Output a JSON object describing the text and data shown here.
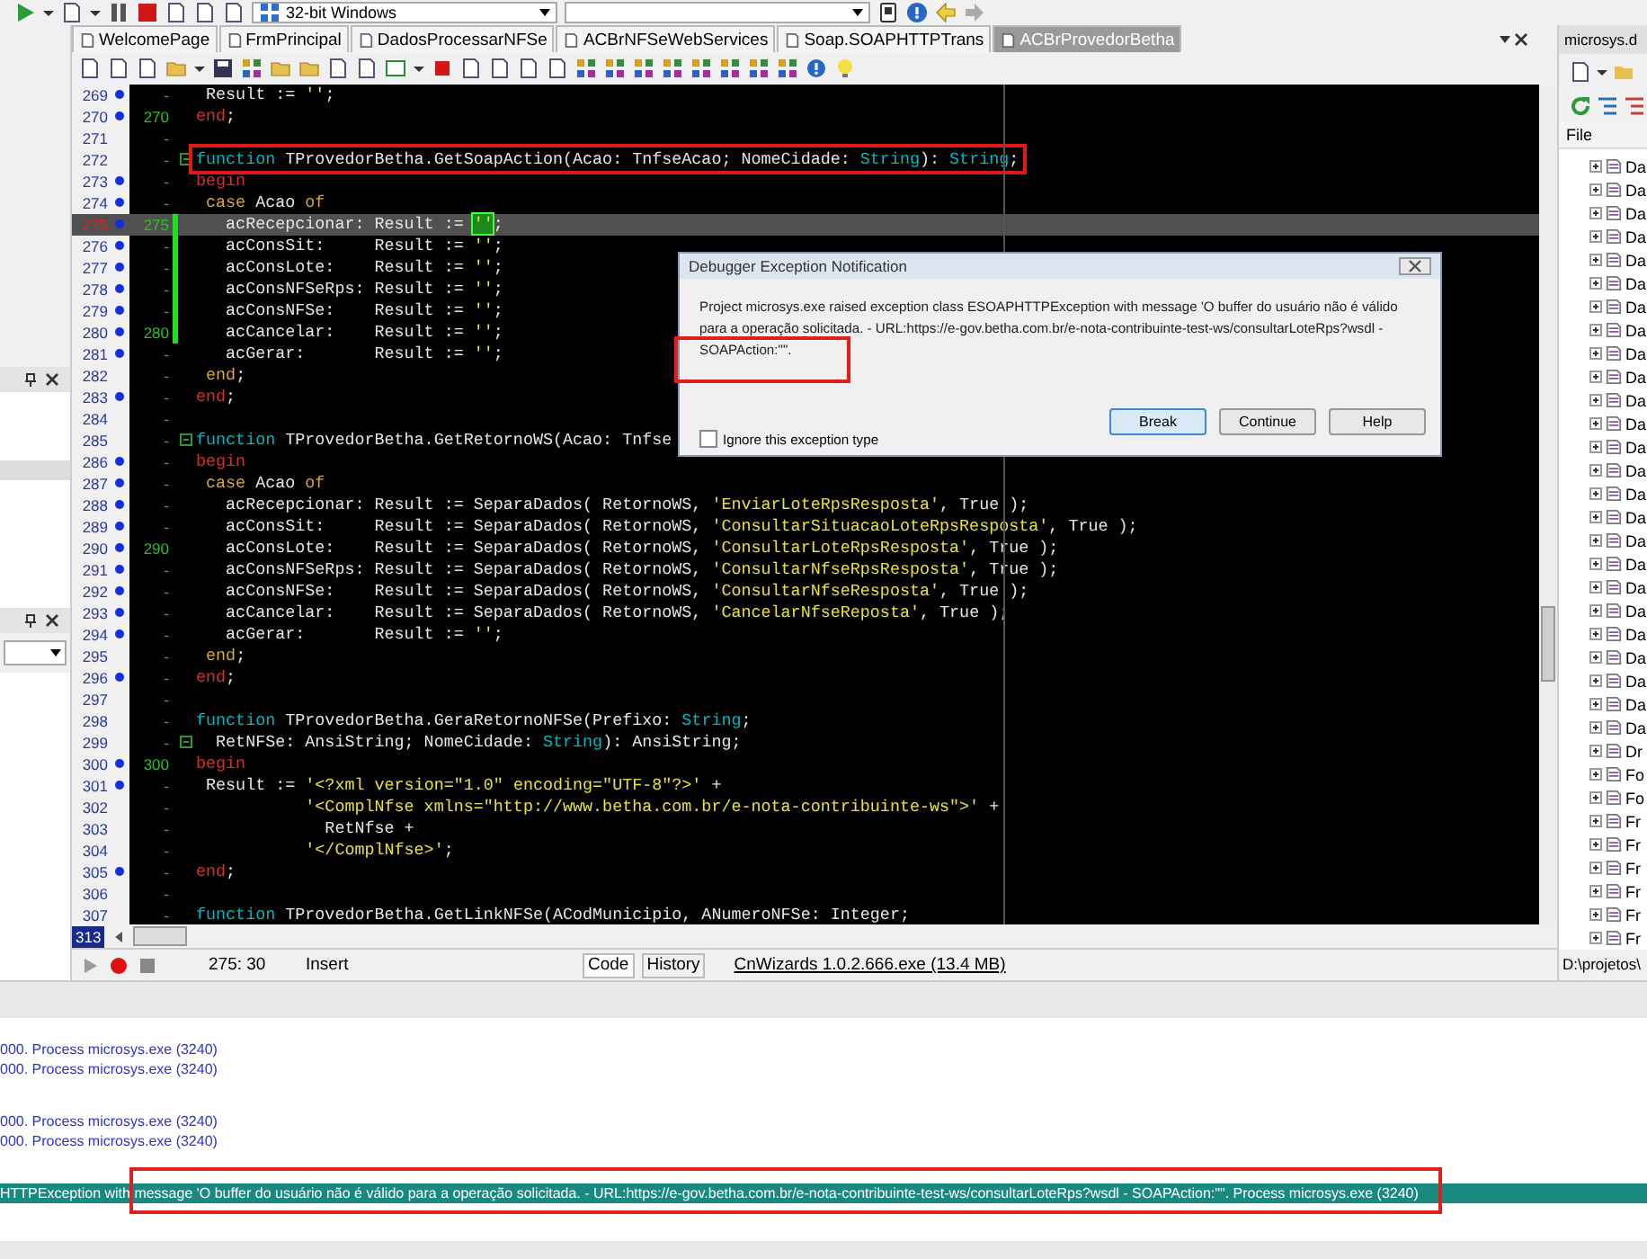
{
  "toolbar": {
    "platform": "32-bit Windows"
  },
  "editor_tabs": [
    {
      "label": "WelcomePage",
      "selected": false
    },
    {
      "label": "FrmPrincipal",
      "selected": false
    },
    {
      "label": "DadosProcessarNFSe",
      "selected": false
    },
    {
      "label": "ACBrNFSeWebServices",
      "selected": false
    },
    {
      "label": "Soap.SOAPHTTPTrans",
      "selected": false
    },
    {
      "label": "ACBrProvedorBetha",
      "selected": true
    }
  ],
  "code": {
    "lines": [
      {
        "n": "269",
        "dot": true,
        "mark": "-",
        "fold": false,
        "changed": false,
        "current": false,
        "boxed": false,
        "tokens": [
          {
            "text": " Result := ",
            "kind": "plain"
          },
          {
            "text": "''",
            "kind": "string"
          },
          {
            "text": ";",
            "kind": "plain"
          }
        ]
      },
      {
        "n": "270",
        "dot": true,
        "mark": "270",
        "fold": false,
        "changed": false,
        "current": false,
        "boxed": false,
        "tokens": [
          {
            "text": "end",
            "kind": "block"
          },
          {
            "text": ";",
            "kind": "plain"
          }
        ]
      },
      {
        "n": "271",
        "dot": false,
        "mark": "-",
        "fold": false,
        "changed": false,
        "current": false
      },
      {
        "n": "272",
        "dot": false,
        "mark": "-",
        "fold": true,
        "changed": false,
        "current": false,
        "boxed": true,
        "tokens": [
          {
            "text": "function",
            "kind": "keyword"
          },
          {
            "text": " TProvedorBetha.GetSoapAction(Acao: TnfseAcao; NomeCidade: ",
            "kind": "plain"
          },
          {
            "text": "String",
            "kind": "keyword"
          },
          {
            "text": "): ",
            "kind": "plain"
          },
          {
            "text": "String",
            "kind": "keyword"
          },
          {
            "text": ";",
            "kind": "plain"
          }
        ]
      },
      {
        "n": "273",
        "dot": true,
        "mark": "-",
        "fold": false,
        "changed": false,
        "current": false,
        "boxed": false,
        "tokens": [
          {
            "text": "begin",
            "kind": "block"
          }
        ]
      },
      {
        "n": "274",
        "dot": true,
        "mark": "-",
        "fold": false,
        "changed": false,
        "current": false,
        "boxed": false,
        "tokens": [
          {
            "text": " case",
            "kind": "control"
          },
          {
            "text": " Acao ",
            "kind": "plain"
          },
          {
            "text": "of",
            "kind": "control"
          }
        ]
      },
      {
        "n": "275",
        "dot": true,
        "mark": "275",
        "fold": false,
        "changed": true,
        "current": true,
        "boxed": false,
        "tokens": [
          {
            "text": "   acRecepcionar: Result := ",
            "kind": "plain"
          },
          {
            "text": "''",
            "kind": "cursor"
          },
          {
            "text": ";",
            "kind": "plain"
          }
        ]
      },
      {
        "n": "276",
        "dot": true,
        "mark": "-",
        "fold": false,
        "changed": true,
        "current": false,
        "boxed": false,
        "tokens": [
          {
            "text": "   acConsSit:     Result := ",
            "kind": "plain"
          },
          {
            "text": "''",
            "kind": "string"
          },
          {
            "text": ";",
            "kind": "plain"
          }
        ]
      },
      {
        "n": "277",
        "dot": true,
        "mark": "-",
        "fold": false,
        "changed": true,
        "current": false,
        "boxed": false,
        "tokens": [
          {
            "text": "   acConsLote:    Result := ",
            "kind": "plain"
          },
          {
            "text": "''",
            "kind": "string"
          },
          {
            "text": ";",
            "kind": "plain"
          }
        ]
      },
      {
        "n": "278",
        "dot": true,
        "mark": "-",
        "fold": false,
        "changed": true,
        "current": false,
        "boxed": false,
        "tokens": [
          {
            "text": "   acConsNFSeRps: Result := ",
            "kind": "plain"
          },
          {
            "text": "''",
            "kind": "string"
          },
          {
            "text": ";",
            "kind": "plain"
          }
        ]
      },
      {
        "n": "279",
        "dot": true,
        "mark": "-",
        "fold": false,
        "changed": true,
        "current": false,
        "boxed": false,
        "tokens": [
          {
            "text": "   acConsNFSe:    Result := ",
            "kind": "plain"
          },
          {
            "text": "''",
            "kind": "string"
          },
          {
            "text": ";",
            "kind": "plain"
          }
        ]
      },
      {
        "n": "280",
        "dot": true,
        "mark": "280",
        "fold": false,
        "changed": true,
        "current": false,
        "boxed": false,
        "tokens": [
          {
            "text": "   acCancelar:    Result := ",
            "kind": "plain"
          },
          {
            "text": "''",
            "kind": "string"
          },
          {
            "text": ";",
            "kind": "plain"
          }
        ]
      },
      {
        "n": "281",
        "dot": true,
        "mark": "-",
        "fold": false,
        "changed": false,
        "current": false,
        "boxed": false,
        "tokens": [
          {
            "text": "   acGerar:       Result := ",
            "kind": "plain"
          },
          {
            "text": "''",
            "kind": "string"
          },
          {
            "text": ";",
            "kind": "plain"
          }
        ]
      },
      {
        "n": "282",
        "dot": false,
        "mark": "-",
        "fold": false,
        "changed": false,
        "current": false,
        "boxed": false,
        "tokens": [
          {
            "text": " end",
            "kind": "control"
          },
          {
            "text": ";",
            "kind": "plain"
          }
        ]
      },
      {
        "n": "283",
        "dot": true,
        "mark": "-",
        "fold": false,
        "changed": false,
        "current": false,
        "boxed": false,
        "tokens": [
          {
            "text": "end",
            "kind": "block"
          },
          {
            "text": ";",
            "kind": "plain"
          }
        ]
      },
      {
        "n": "284",
        "dot": false,
        "mark": "-",
        "fold": false,
        "changed": false,
        "current": false
      },
      {
        "n": "285",
        "dot": false,
        "mark": "-",
        "fold": true,
        "changed": false,
        "current": false,
        "boxed": false,
        "tokens": [
          {
            "text": "function",
            "kind": "keyword"
          },
          {
            "text": " TProvedorBetha.GetRetornoWS(Acao: Tnfse",
            "kind": "plain"
          }
        ]
      },
      {
        "n": "286",
        "dot": true,
        "mark": "-",
        "fold": false,
        "changed": false,
        "current": false,
        "boxed": false,
        "tokens": [
          {
            "text": "begin",
            "kind": "block"
          }
        ]
      },
      {
        "n": "287",
        "dot": true,
        "mark": "-",
        "fold": false,
        "changed": false,
        "current": false,
        "boxed": false,
        "tokens": [
          {
            "text": " case",
            "kind": "control"
          },
          {
            "text": " Acao ",
            "kind": "plain"
          },
          {
            "text": "of",
            "kind": "control"
          }
        ]
      },
      {
        "n": "288",
        "dot": true,
        "mark": "-",
        "fold": false,
        "changed": false,
        "current": false,
        "boxed": false,
        "tokens": [
          {
            "text": "   acRecepcionar: Result := SeparaDados( RetornoWS, ",
            "kind": "plain"
          },
          {
            "text": "'EnviarLoteRpsResposta'",
            "kind": "string"
          },
          {
            "text": ", True );",
            "kind": "plain"
          }
        ]
      },
      {
        "n": "289",
        "dot": true,
        "mark": "-",
        "fold": false,
        "changed": false,
        "current": false,
        "boxed": false,
        "tokens": [
          {
            "text": "   acConsSit:     Result := SeparaDados( RetornoWS, ",
            "kind": "plain"
          },
          {
            "text": "'ConsultarSituacaoLoteRpsResposta'",
            "kind": "string"
          },
          {
            "text": ", True );",
            "kind": "plain"
          }
        ]
      },
      {
        "n": "290",
        "dot": true,
        "mark": "290",
        "fold": false,
        "changed": false,
        "current": false,
        "boxed": false,
        "tokens": [
          {
            "text": "   acConsLote:    Result := SeparaDados( RetornoWS, ",
            "kind": "plain"
          },
          {
            "text": "'ConsultarLoteRpsResposta'",
            "kind": "string"
          },
          {
            "text": ", True );",
            "kind": "plain"
          }
        ]
      },
      {
        "n": "291",
        "dot": true,
        "mark": "-",
        "fold": false,
        "changed": false,
        "current": false,
        "boxed": false,
        "tokens": [
          {
            "text": "   acConsNFSeRps: Result := SeparaDados( RetornoWS, ",
            "kind": "plain"
          },
          {
            "text": "'ConsultarNfseRpsResposta'",
            "kind": "string"
          },
          {
            "text": ", True );",
            "kind": "plain"
          }
        ]
      },
      {
        "n": "292",
        "dot": true,
        "mark": "-",
        "fold": false,
        "changed": false,
        "current": false,
        "boxed": false,
        "tokens": [
          {
            "text": "   acConsNFSe:    Result := SeparaDados( RetornoWS, ",
            "kind": "plain"
          },
          {
            "text": "'ConsultarNfseResposta'",
            "kind": "string"
          },
          {
            "text": ", True );",
            "kind": "plain"
          }
        ]
      },
      {
        "n": "293",
        "dot": true,
        "mark": "-",
        "fold": false,
        "changed": false,
        "current": false,
        "boxed": false,
        "tokens": [
          {
            "text": "   acCancelar:    Result := SeparaDados( RetornoWS, ",
            "kind": "plain"
          },
          {
            "text": "'CancelarNfseReposta'",
            "kind": "string"
          },
          {
            "text": ", True );",
            "kind": "plain"
          }
        ]
      },
      {
        "n": "294",
        "dot": true,
        "mark": "-",
        "fold": false,
        "changed": false,
        "current": false,
        "boxed": false,
        "tokens": [
          {
            "text": "   acGerar:       Result := ",
            "kind": "plain"
          },
          {
            "text": "''",
            "kind": "string"
          },
          {
            "text": ";",
            "kind": "plain"
          }
        ]
      },
      {
        "n": "295",
        "dot": false,
        "mark": "-",
        "fold": false,
        "changed": false,
        "current": false,
        "boxed": false,
        "tokens": [
          {
            "text": " end",
            "kind": "control"
          },
          {
            "text": ";",
            "kind": "plain"
          }
        ]
      },
      {
        "n": "296",
        "dot": true,
        "mark": "-",
        "fold": false,
        "changed": false,
        "current": false,
        "boxed": false,
        "tokens": [
          {
            "text": "end",
            "kind": "block"
          },
          {
            "text": ";",
            "kind": "plain"
          }
        ]
      },
      {
        "n": "297",
        "dot": false,
        "mark": "-",
        "fold": false,
        "changed": false,
        "current": false
      },
      {
        "n": "298",
        "dot": false,
        "mark": "-",
        "fold": false,
        "changed": false,
        "current": false,
        "boxed": false,
        "tokens": [
          {
            "text": "function",
            "kind": "keyword"
          },
          {
            "text": " TProvedorBetha.GeraRetornoNFSe(Prefixo: ",
            "kind": "plain"
          },
          {
            "text": "String",
            "kind": "keyword"
          },
          {
            "text": ";",
            "kind": "plain"
          }
        ]
      },
      {
        "n": "299",
        "dot": false,
        "mark": "-",
        "fold": true,
        "changed": false,
        "current": false,
        "boxed": false,
        "tokens": [
          {
            "text": "  RetNFSe: AnsiString; NomeCidade: ",
            "kind": "plain"
          },
          {
            "text": "String",
            "kind": "keyword"
          },
          {
            "text": "): AnsiString;",
            "kind": "plain"
          }
        ]
      },
      {
        "n": "300",
        "dot": true,
        "mark": "300",
        "fold": false,
        "changed": false,
        "current": false,
        "boxed": false,
        "tokens": [
          {
            "text": "begin",
            "kind": "block"
          }
        ]
      },
      {
        "n": "301",
        "dot": true,
        "mark": "-",
        "fold": false,
        "changed": false,
        "current": false,
        "boxed": false,
        "tokens": [
          {
            "text": " Result := ",
            "kind": "plain"
          },
          {
            "text": "'<?xml version=\"1.0\" encoding=\"UTF-8\"?>'",
            "kind": "string"
          },
          {
            "text": " +",
            "kind": "plain"
          }
        ]
      },
      {
        "n": "302",
        "dot": false,
        "mark": "-",
        "fold": false,
        "changed": false,
        "current": false,
        "boxed": false,
        "tokens": [
          {
            "text": "           '<ComplNfse xmlns=\"http://www.betha.com.br/e-nota-contribuinte-ws\">'",
            "kind": "string"
          },
          {
            "text": " +",
            "kind": "plain"
          }
        ]
      },
      {
        "n": "303",
        "dot": false,
        "mark": "-",
        "fold": false,
        "changed": false,
        "current": false,
        "boxed": false,
        "tokens": [
          {
            "text": "             RetNfse +",
            "kind": "plain"
          }
        ]
      },
      {
        "n": "304",
        "dot": false,
        "mark": "-",
        "fold": false,
        "changed": false,
        "current": false,
        "boxed": false,
        "tokens": [
          {
            "text": "           '</ComplNfse>'",
            "kind": "string"
          },
          {
            "text": ";",
            "kind": "plain"
          }
        ]
      },
      {
        "n": "305",
        "dot": true,
        "mark": "-",
        "fold": false,
        "changed": false,
        "current": false,
        "boxed": false,
        "tokens": [
          {
            "text": "end",
            "kind": "block"
          },
          {
            "text": ";",
            "kind": "plain"
          }
        ]
      },
      {
        "n": "306",
        "dot": false,
        "mark": "-",
        "fold": false,
        "changed": false,
        "current": false
      },
      {
        "n": "307",
        "dot": false,
        "mark": "-",
        "fold": false,
        "changed": false,
        "current": false,
        "boxed": false,
        "tokens": [
          {
            "text": "function",
            "kind": "keyword"
          },
          {
            "text": " TProvedorBetha.GetLinkNFSe(ACodMunicipio, ANumeroNFSe: Integer;",
            "kind": "plain"
          }
        ]
      }
    ],
    "bottom_line": "313"
  },
  "dialog": {
    "title": "Debugger Exception Notification",
    "message": "Project microsys.exe raised exception class ESOAPHTTPException with message 'O buffer do usuário não é válido para a operação solicitada. - URL:https://e-gov.betha.com.br/e-nota-contribuinte-test-ws/consultarLoteRps?wsdl - SOAPAction:\"\".",
    "highlighted": true,
    "ignore_checkbox": {
      "label": "Ignore this exception type",
      "checked": false
    },
    "buttons": [
      {
        "label": "Break",
        "selected": true
      },
      {
        "label": "Continue",
        "selected": false
      },
      {
        "label": "Help",
        "selected": false
      }
    ]
  },
  "status_bar": {
    "position": "275: 30",
    "mode": "Insert",
    "view_tabs": [
      {
        "label": "Code",
        "selected": true
      },
      {
        "label": "History",
        "selected": false
      }
    ],
    "link": "CnWizards 1.0.2.666.exe (13.4 MB)"
  },
  "project_panel": {
    "title": "microsys.d",
    "column": "File",
    "items": [
      "Da",
      "Da",
      "Da",
      "Da",
      "Da",
      "Da",
      "Da",
      "Da",
      "Da",
      "Da",
      "Da",
      "Da",
      "Da",
      "Da",
      "Da",
      "Da",
      "Da",
      "Da",
      "Da",
      "Da",
      "Da",
      "Da",
      "Da",
      "Da",
      "Da",
      "Dr",
      "Fo",
      "Fo",
      "Fr",
      "Fr",
      "Fr",
      "Fr",
      "Fr",
      "Fr"
    ],
    "path": "D:\\projetos\\"
  },
  "messages": {
    "groups": [
      [
        {
          "text": "000. Process microsys.exe (3240)",
          "selected": false,
          "highlighted": false
        },
        {
          "text": "000. Process microsys.exe (3240)",
          "selected": false,
          "highlighted": false
        }
      ],
      [
        {
          "text": "000. Process microsys.exe (3240)",
          "selected": false,
          "highlighted": false
        },
        {
          "text": "000. Process microsys.exe (3240)",
          "selected": false,
          "highlighted": false
        }
      ],
      [
        {
          "text": "HTTPException with message 'O buffer do usuário não é válido para a operação solicitada. - URL:https://e-gov.betha.com.br/e-nota-contribuinte-test-ws/consultarLoteRps?wsdl - SOAPAction:\"\". Process microsys.exe (3240)",
          "selected": true,
          "highlighted": true
        }
      ]
    ]
  }
}
